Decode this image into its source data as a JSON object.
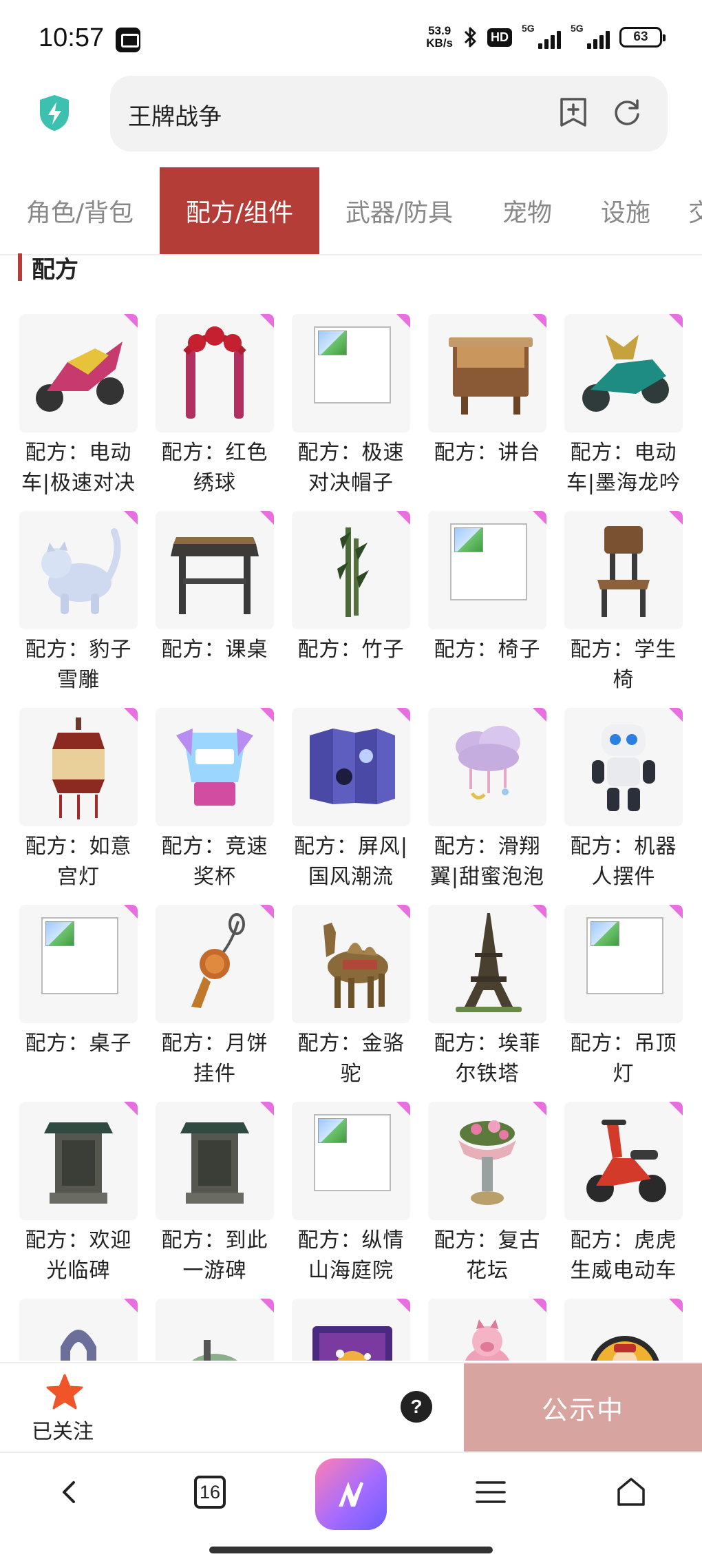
{
  "status_bar": {
    "time": "10:57",
    "net_speed_value": "53.9",
    "net_speed_unit": "KB/s",
    "hd_label": "HD",
    "sim1_label": "5G",
    "sim2_label": "5G",
    "battery": "63"
  },
  "header": {
    "search_text": "王牌战争"
  },
  "tabs": [
    {
      "label": "角色/背包",
      "active": false
    },
    {
      "label": "配方/组件",
      "active": true
    },
    {
      "label": "武器/防具",
      "active": false
    },
    {
      "label": "宠物",
      "active": false
    },
    {
      "label": "设施",
      "active": false
    },
    {
      "label": "交",
      "active": false
    }
  ],
  "section": {
    "title": "配方"
  },
  "items": [
    {
      "line1": "配方：电动",
      "line2": "车|极速对决",
      "icon": "motorbike-icon"
    },
    {
      "line1": "配方：红色",
      "line2": "绣球",
      "icon": "red-ball-arch-icon"
    },
    {
      "line1": "配方：极速",
      "line2": "对决帽子",
      "icon": "broken-image-icon"
    },
    {
      "line1": "配方：讲台",
      "line2": "",
      "icon": "lectern-icon"
    },
    {
      "line1": "配方：电动",
      "line2": "车|墨海龙吟",
      "icon": "dragon-motorbike-icon"
    },
    {
      "line1": "配方：豹子",
      "line2": "雪雕",
      "icon": "snow-leopard-icon"
    },
    {
      "line1": "配方：课桌",
      "line2": "",
      "icon": "desk-icon"
    },
    {
      "line1": "配方：竹子",
      "line2": "",
      "icon": "bamboo-icon"
    },
    {
      "line1": "配方：椅子",
      "line2": "",
      "icon": "broken-image-icon"
    },
    {
      "line1": "配方：学生",
      "line2": "椅",
      "icon": "chair-icon"
    },
    {
      "line1": "配方：如意",
      "line2": "宫灯",
      "icon": "lantern-icon"
    },
    {
      "line1": "配方：竞速",
      "line2": "奖杯",
      "icon": "trophy-icon"
    },
    {
      "line1": "配方：屏风|",
      "line2": "国风潮流",
      "icon": "folding-screen-icon"
    },
    {
      "line1": "配方：滑翔",
      "line2": "翼|甜蜜泡泡",
      "icon": "cloud-glider-icon"
    },
    {
      "line1": "配方：机器",
      "line2": "人摆件",
      "icon": "robot-icon"
    },
    {
      "line1": "配方：桌子",
      "line2": "",
      "icon": "broken-image-icon"
    },
    {
      "line1": "配方：月饼",
      "line2": "挂件",
      "icon": "mooncake-pendant-icon"
    },
    {
      "line1": "配方：金骆",
      "line2": "驼",
      "icon": "camel-icon"
    },
    {
      "line1": "配方：埃菲",
      "line2": "尔铁塔",
      "icon": "eiffel-tower-icon"
    },
    {
      "line1": "配方：吊顶",
      "line2": "灯",
      "icon": "broken-image-icon"
    },
    {
      "line1": "配方：欢迎",
      "line2": "光临碑",
      "icon": "stele-icon"
    },
    {
      "line1": "配方：到此",
      "line2": "一游碑",
      "icon": "stele-icon"
    },
    {
      "line1": "配方：纵情",
      "line2": "山海庭院",
      "icon": "broken-image-icon"
    },
    {
      "line1": "配方：复古",
      "line2": "花坛",
      "icon": "flower-bed-icon"
    },
    {
      "line1": "配方：虎虎",
      "line2": "生威电动车",
      "icon": "scooter-icon"
    },
    {
      "line1": "",
      "line2": "",
      "icon": "horseshoe-icon"
    },
    {
      "line1": "",
      "line2": "",
      "icon": "vespa-icon"
    },
    {
      "line1": "",
      "line2": "",
      "icon": "fireworks-frame-icon"
    },
    {
      "line1": "",
      "line2": "",
      "icon": "pig-ornament-icon"
    },
    {
      "line1": "",
      "line2": "",
      "icon": "god-of-wealth-plate-icon"
    }
  ],
  "action_bar": {
    "follow_label": "已关注",
    "help_glyph": "?",
    "status_label": "公示中"
  },
  "nav_bar": {
    "tab_count": "16"
  },
  "colors": {
    "accent": "#b43e37",
    "corner_tag": "#e86fe0",
    "status_button": "#d8a4a0",
    "star": "#f0552a"
  }
}
